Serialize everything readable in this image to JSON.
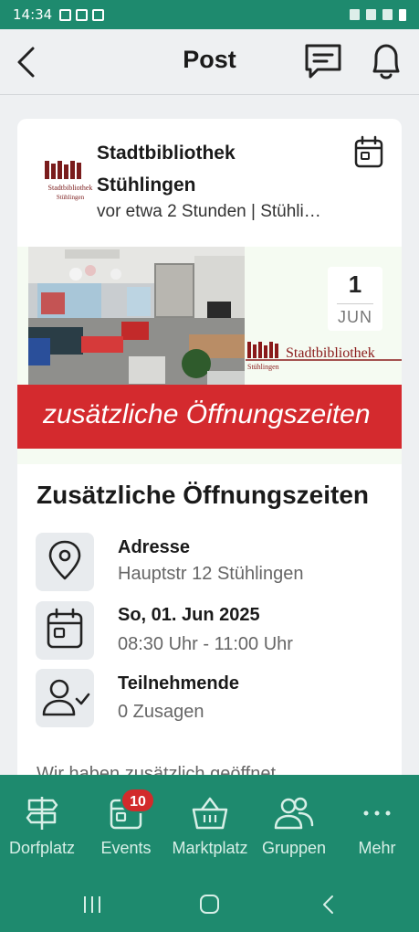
{
  "status_bar": {
    "time": "14:34"
  },
  "header": {
    "title": "Post",
    "icons": {
      "back": "back-arrow-icon",
      "chat": "chat-icon",
      "bell": "bell-icon"
    }
  },
  "post": {
    "org_line1": "Stadtbibliothek",
    "org_line2": "Stühlingen",
    "meta": "vor etwa 2 Stunden | Stühli…",
    "logo_text1": "Stadtbibliothek",
    "logo_text2": "Stühlingen",
    "banner": {
      "date_day": "1",
      "date_month": "JUN",
      "brand": "Stadtbibliothek",
      "brand_sub": "Stühlingen",
      "band_text": "zusätzliche Öffnungszeiten"
    },
    "event_title": "Zusätzliche Öffnungszeiten",
    "address_label": "Adresse",
    "address_value": "Hauptstr 12 Stühlingen",
    "date_label": "So, 01. Jun 2025",
    "date_value": "08:30 Uhr - 11:00 Uhr",
    "participants_label": "Teilnehmende",
    "participants_value": "0 Zusagen",
    "cut_text": "Wir haben zusätzlich geöffnet"
  },
  "nav": {
    "items": [
      {
        "label": "Dorfplatz",
        "icon": "signpost-icon"
      },
      {
        "label": "Events",
        "icon": "calendar-icon",
        "badge": "10"
      },
      {
        "label": "Marktplatz",
        "icon": "basket-icon"
      },
      {
        "label": "Gruppen",
        "icon": "group-icon"
      },
      {
        "label": "Mehr",
        "icon": "more-icon"
      }
    ]
  },
  "colors": {
    "brand_green": "#1e8a6e",
    "band_red": "#d42a2e",
    "badge_red": "#d22b2b"
  }
}
